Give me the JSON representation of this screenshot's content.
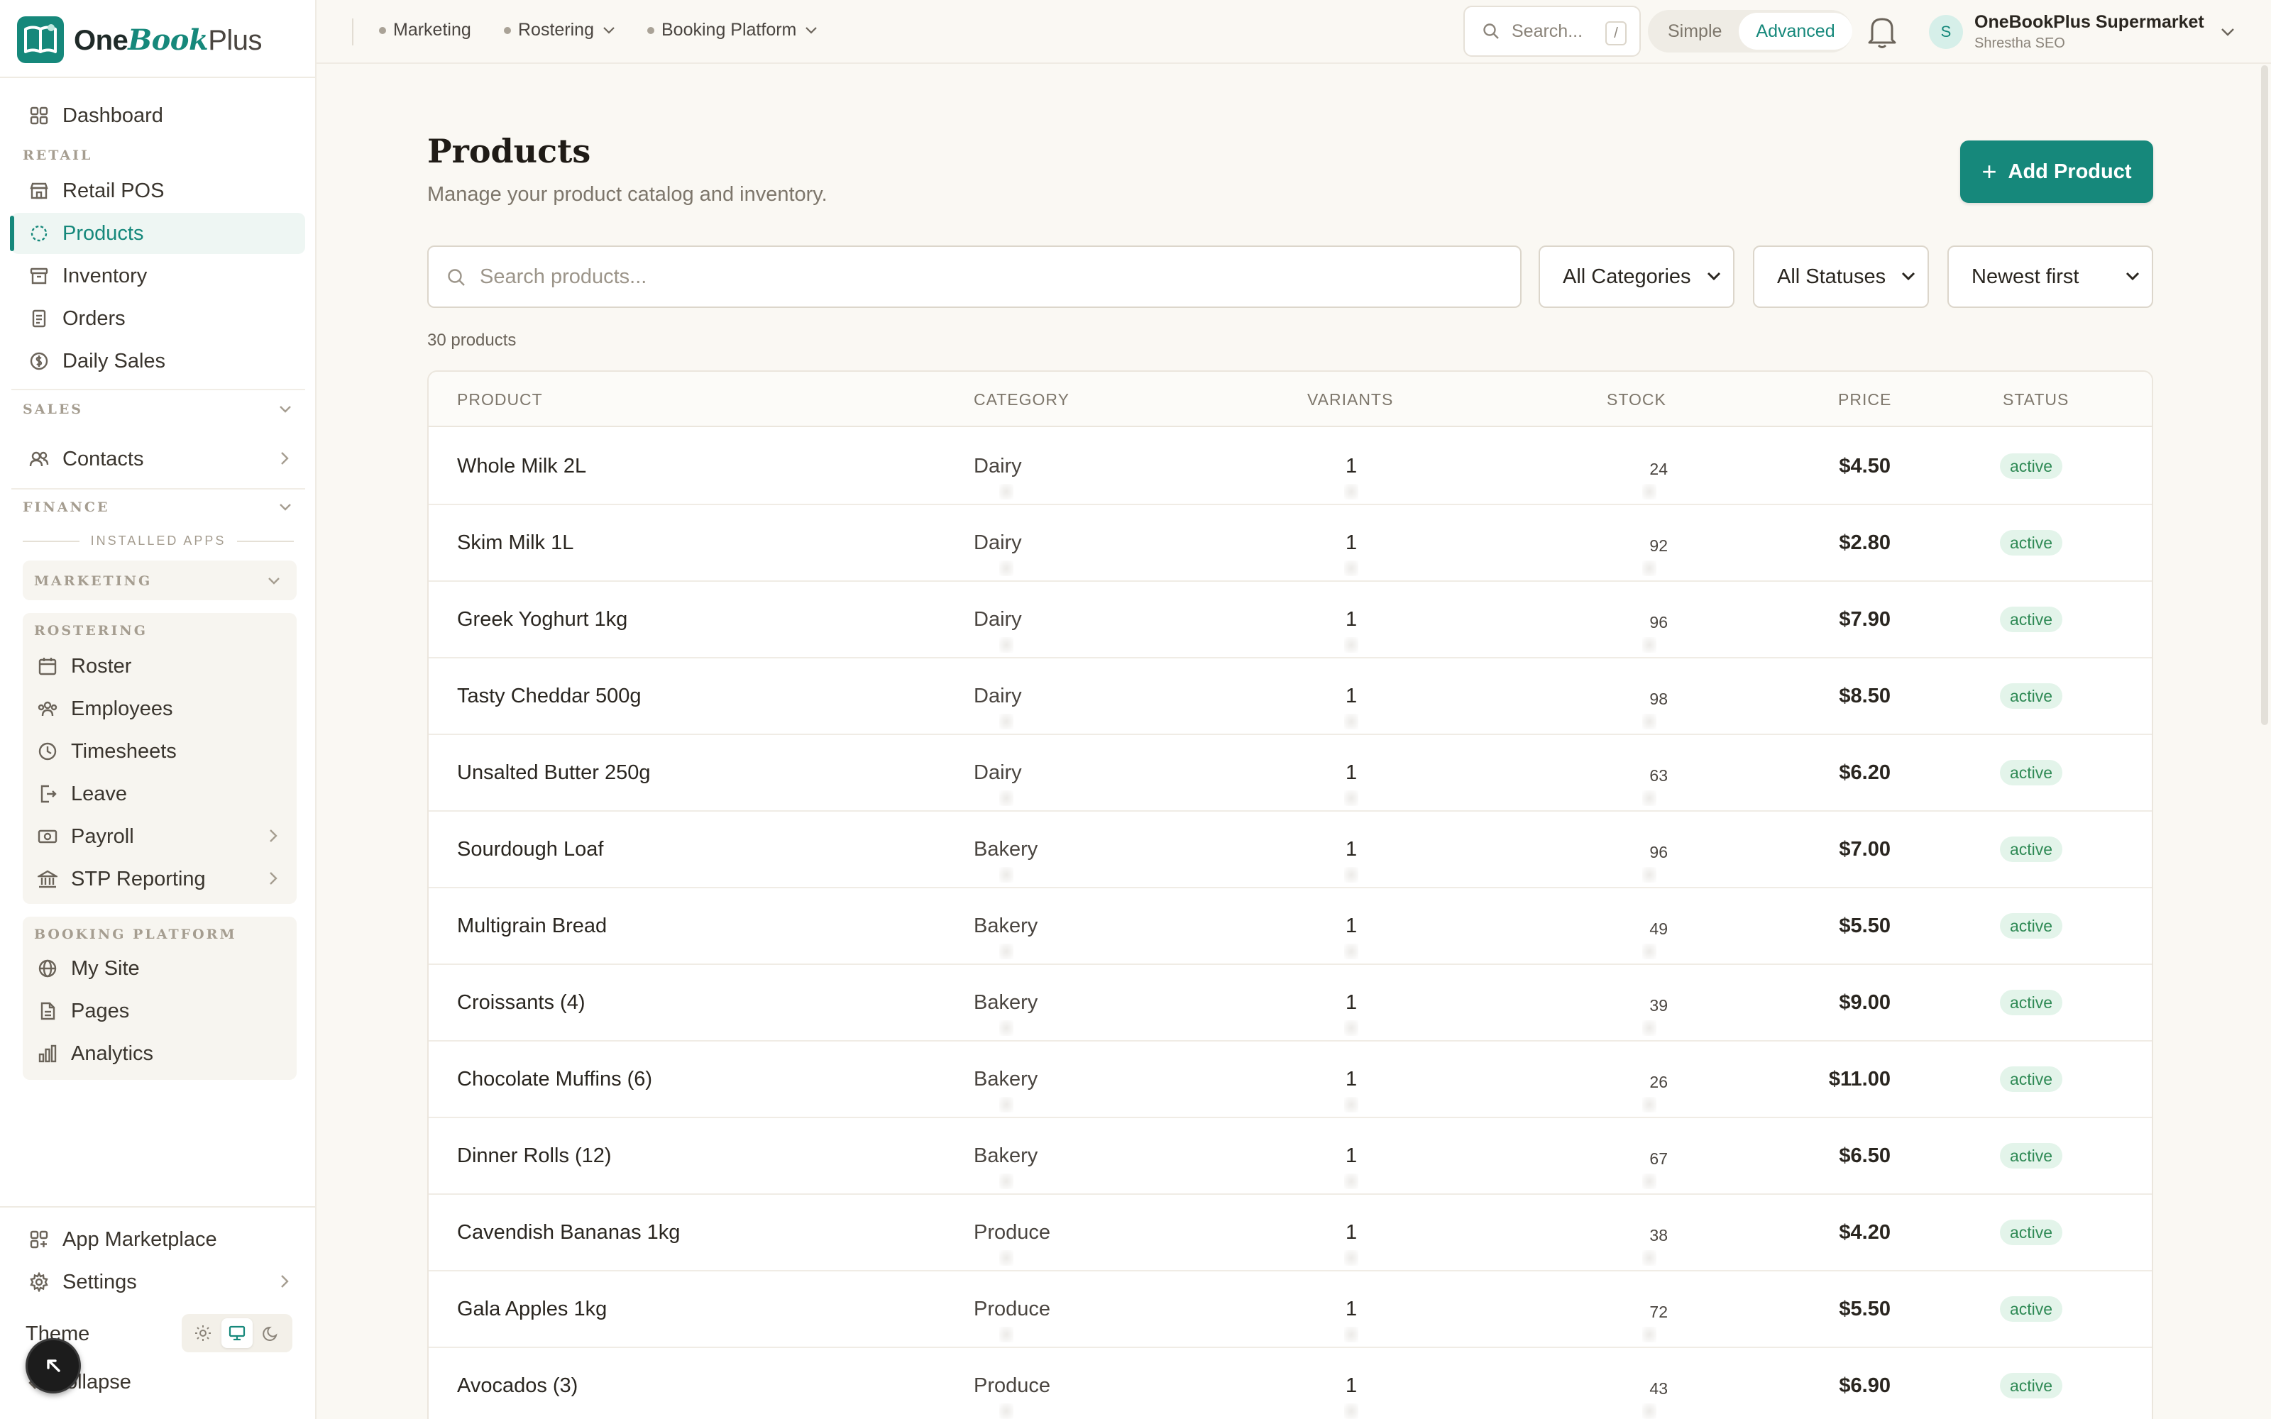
{
  "brand": {
    "name_one": "One",
    "name_book": "Book",
    "name_plus": "Plus"
  },
  "sidebar": {
    "dashboard": "Dashboard",
    "retail_label": "RETAIL",
    "retail_items": [
      "Retail POS",
      "Products",
      "Inventory",
      "Orders",
      "Daily Sales"
    ],
    "active_item": "Products",
    "sales_label": "SALES",
    "contacts": "Contacts",
    "finance_label": "FINANCE",
    "installed_apps_label": "INSTALLED APPS",
    "marketing_label": "MARKETING",
    "rostering_label": "ROSTERING",
    "rostering_items": [
      "Roster",
      "Employees",
      "Timesheets",
      "Leave",
      "Payroll",
      "STP Reporting"
    ],
    "booking_label": "BOOKING PLATFORM",
    "booking_items": [
      "My Site",
      "Pages",
      "Analytics"
    ],
    "app_marketplace": "App Marketplace",
    "settings": "Settings",
    "theme": "Theme",
    "collapse": "Collapse"
  },
  "topbar": {
    "crumbs": [
      "Marketing",
      "Rostering",
      "Booking Platform"
    ],
    "search_placeholder": "Search...",
    "search_shortcut": "/",
    "mode_simple": "Simple",
    "mode_advanced": "Advanced",
    "account_initial": "S",
    "account_name": "OneBookPlus Supermarket",
    "account_role": "Shrestha SEO"
  },
  "page": {
    "title": "Products",
    "subtitle": "Manage your product catalog and inventory.",
    "add_button": "Add Product",
    "search_placeholder": "Search products...",
    "filter_category": "All Categories",
    "filter_status": "All Statuses",
    "sort": "Newest first",
    "count_label": "30 products"
  },
  "table": {
    "headers": {
      "product": "PRODUCT",
      "category": "CATEGORY",
      "variants": "VARIANTS",
      "stock": "STOCK",
      "price": "PRICE",
      "status": "STATUS"
    },
    "rows": [
      {
        "name": "Whole Milk 2L",
        "category": "Dairy",
        "variants": "1",
        "stock": "24",
        "price": "$4.50",
        "status": "active"
      },
      {
        "name": "Skim Milk 1L",
        "category": "Dairy",
        "variants": "1",
        "stock": "92",
        "price": "$2.80",
        "status": "active"
      },
      {
        "name": "Greek Yoghurt 1kg",
        "category": "Dairy",
        "variants": "1",
        "stock": "96",
        "price": "$7.90",
        "status": "active"
      },
      {
        "name": "Tasty Cheddar 500g",
        "category": "Dairy",
        "variants": "1",
        "stock": "98",
        "price": "$8.50",
        "status": "active"
      },
      {
        "name": "Unsalted Butter 250g",
        "category": "Dairy",
        "variants": "1",
        "stock": "63",
        "price": "$6.20",
        "status": "active"
      },
      {
        "name": "Sourdough Loaf",
        "category": "Bakery",
        "variants": "1",
        "stock": "96",
        "price": "$7.00",
        "status": "active"
      },
      {
        "name": "Multigrain Bread",
        "category": "Bakery",
        "variants": "1",
        "stock": "49",
        "price": "$5.50",
        "status": "active"
      },
      {
        "name": "Croissants (4)",
        "category": "Bakery",
        "variants": "1",
        "stock": "39",
        "price": "$9.00",
        "status": "active"
      },
      {
        "name": "Chocolate Muffins (6)",
        "category": "Bakery",
        "variants": "1",
        "stock": "26",
        "price": "$11.00",
        "status": "active"
      },
      {
        "name": "Dinner Rolls (12)",
        "category": "Bakery",
        "variants": "1",
        "stock": "67",
        "price": "$6.50",
        "status": "active"
      },
      {
        "name": "Cavendish Bananas 1kg",
        "category": "Produce",
        "variants": "1",
        "stock": "38",
        "price": "$4.20",
        "status": "active"
      },
      {
        "name": "Gala Apples 1kg",
        "category": "Produce",
        "variants": "1",
        "stock": "72",
        "price": "$5.50",
        "status": "active"
      },
      {
        "name": "Avocados (3)",
        "category": "Produce",
        "variants": "1",
        "stock": "43",
        "price": "$6.90",
        "status": "active"
      }
    ]
  },
  "colors": {
    "accent": "#16887b",
    "active_badge_bg": "#e3f4ea",
    "active_badge_text": "#2f8a55",
    "page_bg": "#faf8f3"
  }
}
